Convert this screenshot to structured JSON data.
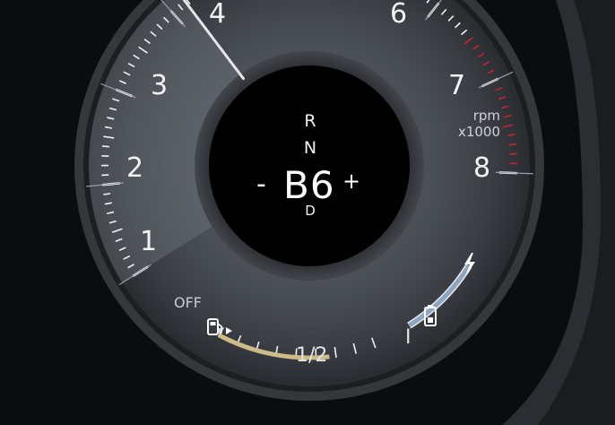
{
  "gear": {
    "upper1": "R",
    "upper2": "N",
    "minus": "-",
    "current": "B6",
    "plus": "+",
    "lower": "D"
  },
  "tachometer": {
    "unit_line1": "rpm",
    "unit_line2": "x1000",
    "marks": [
      "1",
      "2",
      "3",
      "4",
      "6",
      "7",
      "8"
    ],
    "needle_value": 3.4,
    "redline_start": 6.5
  },
  "charge_gauge": {
    "marker": "I",
    "level": 0.6
  },
  "fuel_gauge": {
    "off_label": "OFF",
    "half_label": "1/2",
    "level": 0.4
  },
  "colors": {
    "redline": "#c4272b",
    "fuel_bar": "#cdbb88",
    "charge_bar": "#8fa6c2",
    "needle": "#e6e6e6"
  }
}
